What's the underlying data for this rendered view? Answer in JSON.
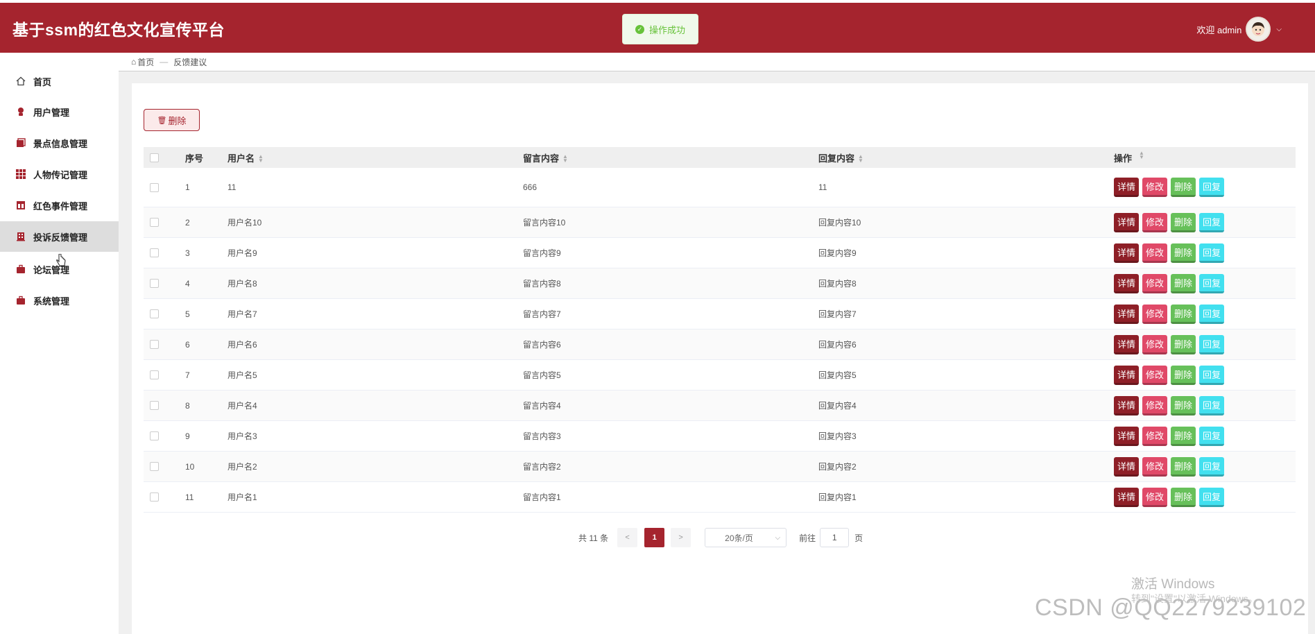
{
  "app": {
    "title": "基于ssm的红色文化宣传平台"
  },
  "toast": {
    "text": "操作成功"
  },
  "user": {
    "greeting": "欢迎 admin"
  },
  "sidebar": {
    "items": [
      {
        "label": "首页",
        "icon": "home-icon"
      },
      {
        "label": "用户管理",
        "icon": "user-icon"
      },
      {
        "label": "景点信息管理",
        "icon": "folder-icon"
      },
      {
        "label": "人物传记管理",
        "icon": "grid-icon"
      },
      {
        "label": "红色事件管理",
        "icon": "table-icon"
      },
      {
        "label": "投诉反馈管理",
        "icon": "building-icon"
      },
      {
        "label": "论坛管理",
        "icon": "briefcase-icon"
      },
      {
        "label": "系统管理",
        "icon": "briefcase-icon"
      }
    ],
    "active_index": 5
  },
  "breadcrumb": {
    "home": "首页",
    "separator": "—",
    "current": "反馈建议"
  },
  "toolbar": {
    "delete_label": "删除"
  },
  "table": {
    "headers": {
      "index": "序号",
      "username": "用户名",
      "message": "留言内容",
      "reply": "回复内容",
      "operations": "操作"
    },
    "row_actions": {
      "detail": "详情",
      "edit": "修改",
      "delete": "删除",
      "reply": "回复"
    },
    "rows": [
      {
        "index": "1",
        "username": "11",
        "message": "666",
        "reply": "11"
      },
      {
        "index": "2",
        "username": "用户名10",
        "message": "留言内容10",
        "reply": "回复内容10"
      },
      {
        "index": "3",
        "username": "用户名9",
        "message": "留言内容9",
        "reply": "回复内容9"
      },
      {
        "index": "4",
        "username": "用户名8",
        "message": "留言内容8",
        "reply": "回复内容8"
      },
      {
        "index": "5",
        "username": "用户名7",
        "message": "留言内容7",
        "reply": "回复内容7"
      },
      {
        "index": "6",
        "username": "用户名6",
        "message": "留言内容6",
        "reply": "回复内容6"
      },
      {
        "index": "7",
        "username": "用户名5",
        "message": "留言内容5",
        "reply": "回复内容5"
      },
      {
        "index": "8",
        "username": "用户名4",
        "message": "留言内容4",
        "reply": "回复内容4"
      },
      {
        "index": "9",
        "username": "用户名3",
        "message": "留言内容3",
        "reply": "回复内容3"
      },
      {
        "index": "10",
        "username": "用户名2",
        "message": "留言内容2",
        "reply": "回复内容2"
      },
      {
        "index": "11",
        "username": "用户名1",
        "message": "留言内容1",
        "reply": "回复内容1"
      }
    ]
  },
  "pagination": {
    "total_text": "共 11 条",
    "prev": "<",
    "current_page": "1",
    "next": ">",
    "page_size": "20条/页",
    "goto_label": "前往",
    "goto_value": "1",
    "page_suffix": "页"
  },
  "watermarks": {
    "windows_line1": "激活 Windows",
    "windows_line2": "转到\"设置\"以激活 Windows。",
    "csdn": "CSDN @QQ2279239102"
  },
  "colors": {
    "brand": "#a5242e",
    "success": "#67c23a",
    "detail": "#8e1f27",
    "edit": "#e04968",
    "delete": "#67c05a",
    "reply": "#42e0ef"
  }
}
